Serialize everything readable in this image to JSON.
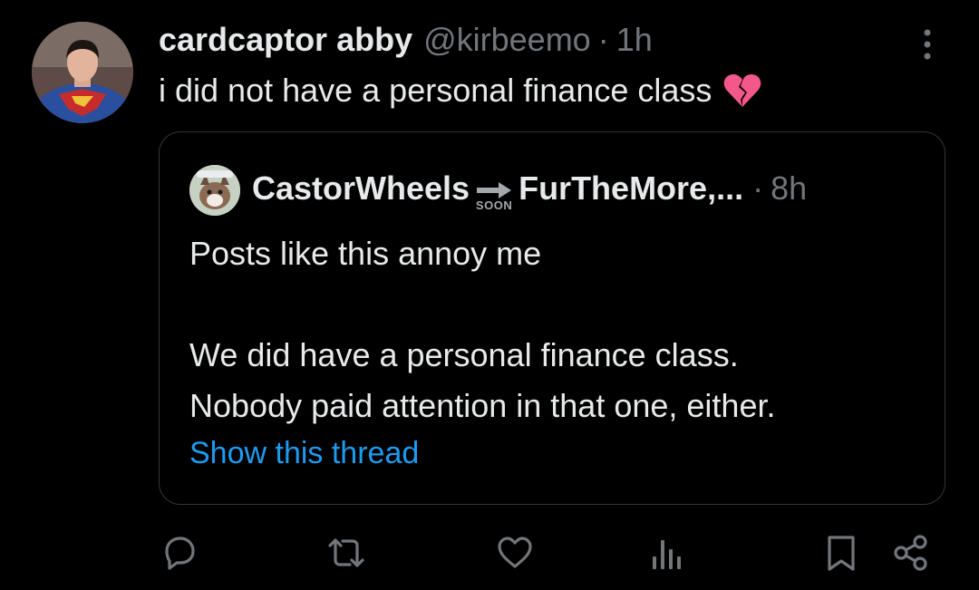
{
  "tweet": {
    "display_name": "cardcaptor abby",
    "handle": "@kirbeemo",
    "separator": "·",
    "time": "1h",
    "text": "i did not have a personal finance class",
    "emoji": "broken-heart-icon"
  },
  "quote": {
    "display_name_part1": "CastorWheels",
    "badge_text": "SOON",
    "display_name_part2": "FurTheMore,...",
    "separator": "·",
    "time": "8h",
    "body_line1": "Posts like this annoy me",
    "body_line2": "We did have a personal finance class.",
    "body_line3": "Nobody paid attention in that one, either.",
    "show_thread": "Show this thread"
  },
  "actions": [
    "reply-icon",
    "repost-icon",
    "like-icon",
    "views-icon",
    "bookmark-icon",
    "share-icon"
  ],
  "colors": {
    "background": "#000000",
    "text": "#e7e9ea",
    "muted": "#71767b",
    "link": "#1d9bf0",
    "border": "#333639",
    "heart": "#f4578a"
  }
}
